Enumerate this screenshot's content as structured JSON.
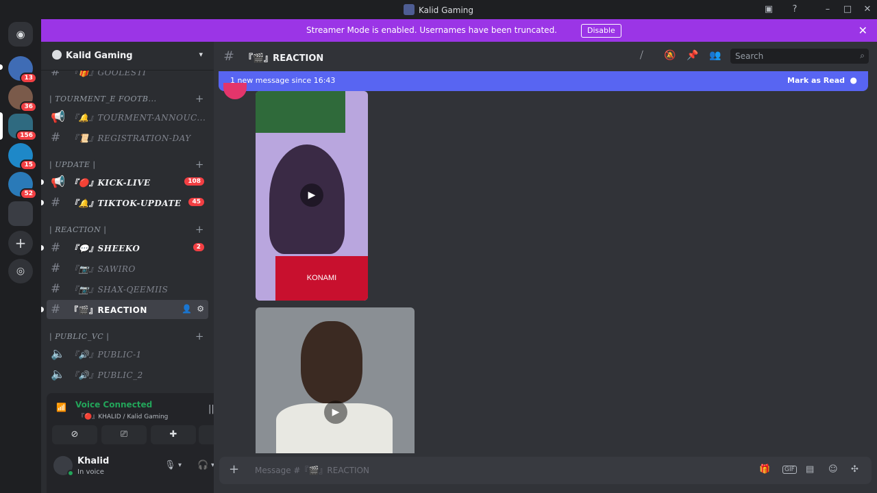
{
  "window": {
    "title": "Kalid Gaming"
  },
  "banner": {
    "message": "Streamer Mode is enabled. Usernames have been truncated.",
    "disable_label": "Disable"
  },
  "servers": {
    "badges": [
      "13",
      "36",
      "156",
      "15",
      "52"
    ]
  },
  "guild": {
    "name": "Kalid Gaming"
  },
  "channels": {
    "partial_top": "『🎁』GOOLESTI",
    "cat_tourment": "| TOURMENT_E FOOTB...",
    "tourment_annouc": "『🔔』TOURMENT-ANNOUC...",
    "registration": "『📜』REGISTRATION-DAY",
    "cat_update": "| UPDATE |",
    "kick_live": "『🔴』KICK-LIVE",
    "kick_live_count": "108",
    "tiktok_update": "『🔔』TIKTOK-UPDATE",
    "tiktok_update_count": "45",
    "cat_reaction": "| REACTION |",
    "sheeko": "『💬』SHEEKO",
    "sheeko_count": "2",
    "sawiro": "『📷』SAWIRO",
    "shax_qeemiis": "『📷』SHAX-QEEMIIS",
    "reaction": "『🎬』REACTION",
    "cat_public_vc": "| PUBLIC_VC |",
    "public_1": "『🔊』PUBLIC-1",
    "public_2": "『🔊』PUBLIC_2"
  },
  "voice": {
    "status": "Voice Connected",
    "channel": "『🔴』KHALID / Kalid Gaming"
  },
  "user": {
    "name": "Khalid",
    "status": "In voice"
  },
  "main": {
    "channel_name": "『🎬』REACTION",
    "search_placeholder": "Search",
    "new_messages": "1 new message since 16:43",
    "mark_read": "Mark as Read",
    "media1_label": "KONAMI",
    "composer_placeholder": "Message #『🎬』REACTION"
  },
  "colors": {
    "banner": "#9b35e6",
    "newbar": "#5865f2",
    "unread_badge": "#f23f43",
    "voice_green": "#23a55a"
  }
}
